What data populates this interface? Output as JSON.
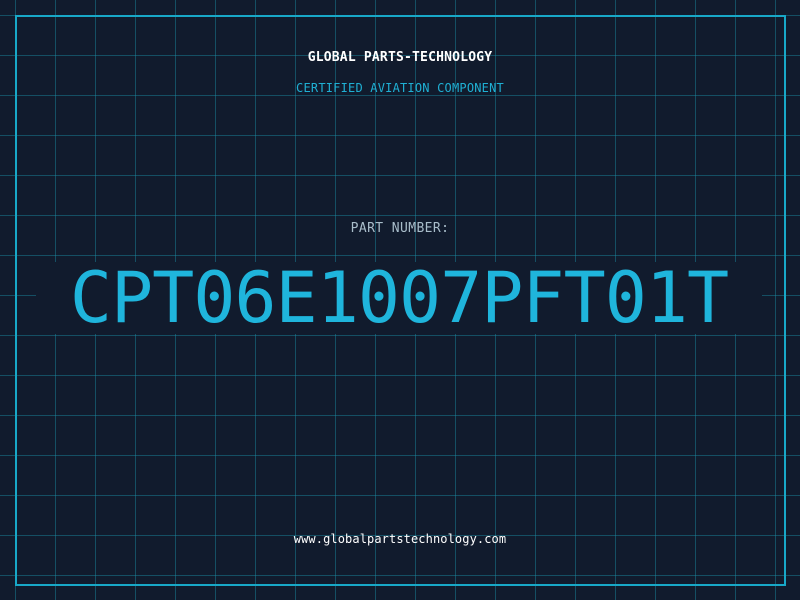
{
  "colors": {
    "background": "#111b2d",
    "grid": "#1a96af",
    "accent": "#18a8c8",
    "part_number": "#1fb5dc",
    "title": "#ffffff",
    "label": "#a9bdca"
  },
  "header": {
    "company_name": "GLOBAL PARTS-TECHNOLOGY",
    "subtitle": "CERTIFIED AVIATION COMPONENT"
  },
  "part": {
    "label": "PART NUMBER:",
    "number": "CPT06E1007PFT01T"
  },
  "footer": {
    "website": "www.globalpartstechnology.com"
  }
}
